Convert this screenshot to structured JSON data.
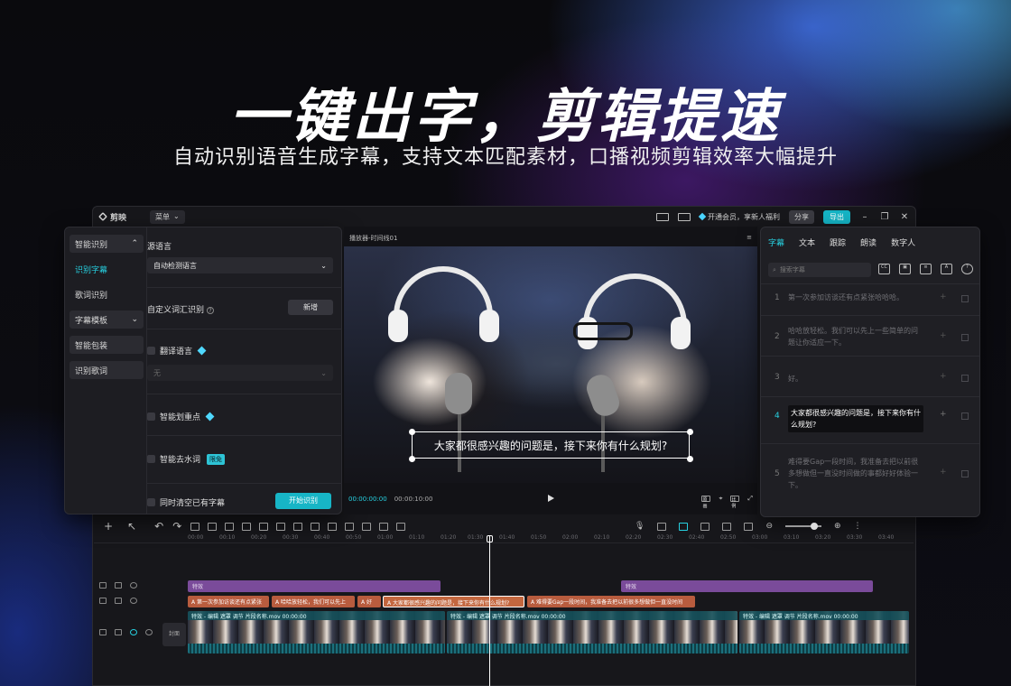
{
  "hero": {
    "title": "一键出字，剪辑提速",
    "subtitle": "自动识别语音生成字幕，支持文本匹配素材，口播视频剪辑效率大幅提升"
  },
  "titlebar": {
    "app_name": "剪映",
    "menu_label": "菜单",
    "vip_text": "开通会员，享新人福利",
    "share_label": "分享",
    "export_label": "导出"
  },
  "left_nav": {
    "group1": "智能识别",
    "item_active": "识别字幕",
    "item2": "歌词识别",
    "group2": "字幕模板",
    "item3": "智能包装",
    "item4": "识别歌词"
  },
  "form": {
    "source_lang_label": "源语言",
    "source_lang_value": "自动检测语言",
    "custom_vocab_label": "自定义词汇识别",
    "new_button": "新增",
    "translate_label": "翻译语言",
    "translate_value": "无",
    "smart_highlight_label": "智能划重点",
    "remove_filler_label": "智能去水词",
    "free_badge": "限免",
    "clear_existing_label": "同时清空已有字幕",
    "start_button": "开始识别"
  },
  "player": {
    "header": "播放器-时间线01",
    "subtitle_text": "大家都很感兴趣的问题是，接下来你有什么规划?",
    "current_time": "00:00:00:00",
    "total_time": "00:00:10:00",
    "btn_original": "原画",
    "btn_ratio": "比例"
  },
  "right_panel": {
    "tabs": [
      "字幕",
      "文本",
      "跟踪",
      "朗读",
      "数字人"
    ],
    "search_placeholder": "搜索字幕",
    "rows": [
      {
        "num": "1",
        "text": "第一次参加访谈还有点紧张哈哈哈。"
      },
      {
        "num": "2",
        "text": "哈哈放轻松。我们可以先上一些简单的问题让你适应一下。"
      },
      {
        "num": "3",
        "text": "好。"
      },
      {
        "num": "4",
        "text": "大家都很感兴趣的问题是，接下来你有什么规划?"
      },
      {
        "num": "5",
        "text": "难得要Gap一段时间，我准备去把以前很多想做但一直没时间做的事都好好体验一下。"
      }
    ]
  },
  "timeline": {
    "ruler": [
      "00:00",
      "00:10",
      "00:20",
      "00:30",
      "00:40",
      "00:50",
      "01:00",
      "01:10",
      "01:20",
      "01:30",
      "01:40",
      "01:50",
      "02:00",
      "02:10",
      "02:20",
      "02:30",
      "02:40",
      "02:50",
      "03:00",
      "03:10",
      "03:20",
      "03:30",
      "03:40"
    ],
    "fx_label": "特效",
    "subtitle_clips": [
      "A 第一次参加访谈还有点紧张",
      "A 哈哈放轻松，我们可以先上",
      "A 好",
      "A 大家都很感兴趣的问题是，接下来你有什么规划?",
      "A 难得要Gap一段时间，我准备去把以前很多想做但一直没时间"
    ],
    "video_clip_label": "特效 - 编辑 遮罩 调节 片段名称.mov 00:00:00",
    "cover_label": "封面"
  },
  "colors": {
    "accent": "#17b5c6",
    "accent_text": "#27d0e0",
    "fx_track": "#7a4b9a",
    "subtitle_track": "#b85c3e"
  }
}
